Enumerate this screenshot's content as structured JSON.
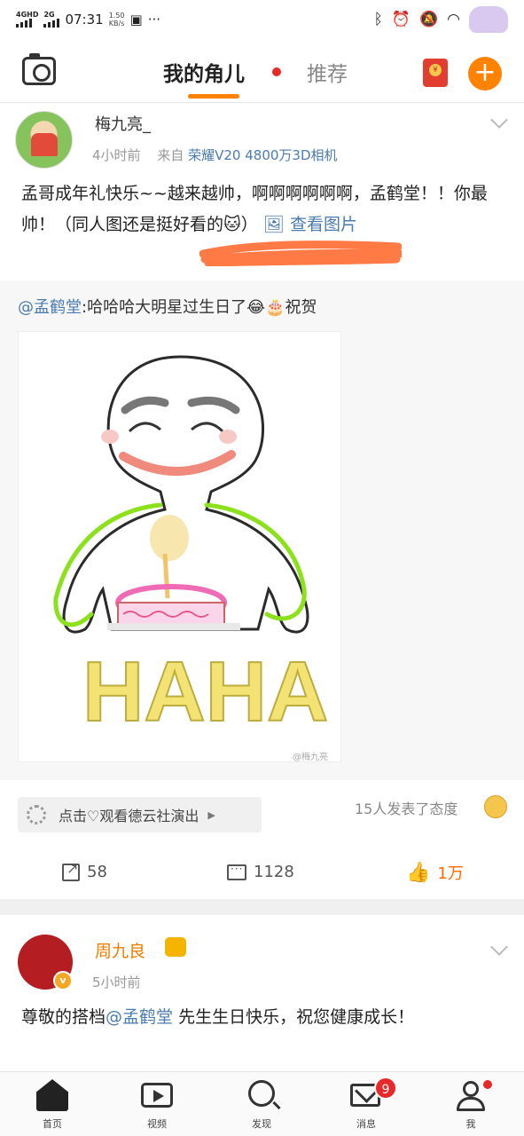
{
  "status_bar": {
    "network_1": "4GHD",
    "network_2": "2G",
    "time": "07:31",
    "speed_value": "1.50",
    "speed_unit": "KB/s",
    "more": "···"
  },
  "top_nav": {
    "active_tab": "我的角儿",
    "other_tab": "推荐",
    "accent_color": "#ff8200"
  },
  "post1": {
    "author": "梅九亮_",
    "time": "4小时前",
    "source_prefix": "来自",
    "source": "荣耀V20 4800万3D相机",
    "text": "孟哥成年礼快乐~~越来越帅，啊啊啊啊啊啊，孟鹤堂！！你最帅！（同人图还是挺好看的🐱）",
    "view_image": "查看图片",
    "repost_at": "@孟鹤堂",
    "repost_text": ":哈哈哈大明星过生日了😂🎂祝贺",
    "image_text": "HAHA",
    "watermark": "@梅九亮",
    "chip_label": "点击♡观看德云社演出",
    "attitude": "15人发表了态度",
    "shares": "58",
    "comments": "1128",
    "likes": "1万"
  },
  "post2": {
    "author": "周九良",
    "time": "5小时前",
    "text_pre": "尊敬的搭档",
    "text_at": "@孟鹤堂",
    "text_post": " 先生生日快乐，祝您健康成长！"
  },
  "bottom_nav": {
    "items": [
      {
        "label": "首页",
        "icon": "home-icon"
      },
      {
        "label": "视频",
        "icon": "video-icon"
      },
      {
        "label": "发现",
        "icon": "discover-icon"
      },
      {
        "label": "消息",
        "icon": "message-icon",
        "badge": "9"
      },
      {
        "label": "我",
        "icon": "profile-icon"
      }
    ]
  }
}
